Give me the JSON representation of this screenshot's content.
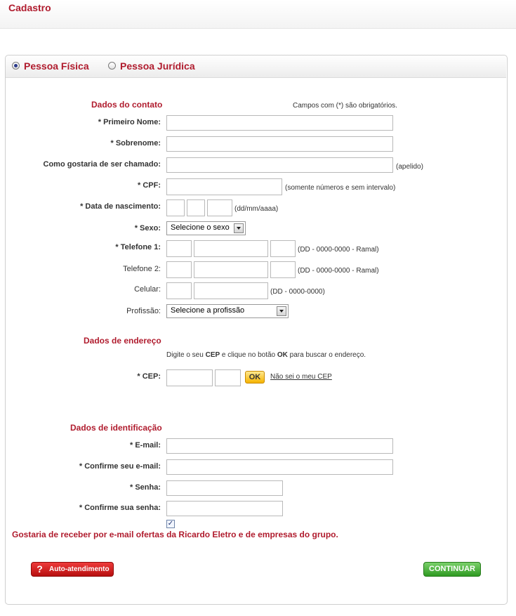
{
  "header": {
    "title": "Cadastro"
  },
  "person_type": {
    "options": [
      "Pessoa Física",
      "Pessoa Jurídica"
    ],
    "selected": "Pessoa Física"
  },
  "contact": {
    "title": "Dados do contato",
    "required_note": "Campos com (*) são obrigatórios.",
    "first_name_label": "* Primeiro Nome:",
    "surname_label": "* Sobrenome:",
    "nickname_label": "Como gostaria de ser chamado:",
    "nickname_hint": "(apelido)",
    "cpf_label": "* CPF:",
    "cpf_hint": "(somente números e sem intervalo)",
    "birth_label": "* Data de nascimento:",
    "birth_hint": "(dd/mm/aaaa)",
    "sex_label": "* Sexo:",
    "sex_value": "Selecione o sexo",
    "phone1_label": "* Telefone 1:",
    "phone1_hint": "(DD - 0000-0000 - Ramal)",
    "phone2_label": "Telefone 2:",
    "phone2_hint": "(DD - 0000-0000 - Ramal)",
    "mobile_label": "Celular:",
    "mobile_hint": "(DD - 0000-0000)",
    "profession_label": "Profissão:",
    "profession_value": "Selecione a profissão"
  },
  "address": {
    "title": "Dados de endereço",
    "instruction": {
      "part1": "Digite o seu ",
      "bold1": "CEP",
      "part2": " e clique no botão ",
      "bold2": "OK",
      "part3": " para buscar o endereço."
    },
    "cep_label": "* CEP:",
    "ok_label": "OK",
    "unknown_cep_link": "Não sei o meu CEP"
  },
  "identification": {
    "title": "Dados de identificação",
    "email_label": "* E-mail:",
    "confirm_email_label": "* Confirme seu e-mail:",
    "password_label": "* Senha:",
    "confirm_password_label": "* Confirme sua senha:"
  },
  "consent": {
    "checked": true,
    "text": "Gostaria de receber por e-mail ofertas da Ricardo Eletro e de empresas do grupo."
  },
  "buttons": {
    "help_label": "Auto-atendimento",
    "continue_label": "CONTINUAR"
  },
  "colors": {
    "accent": "#b01c2e",
    "continue": "#2f9a22",
    "help": "#c91c1c",
    "ok": "#f5b300"
  }
}
